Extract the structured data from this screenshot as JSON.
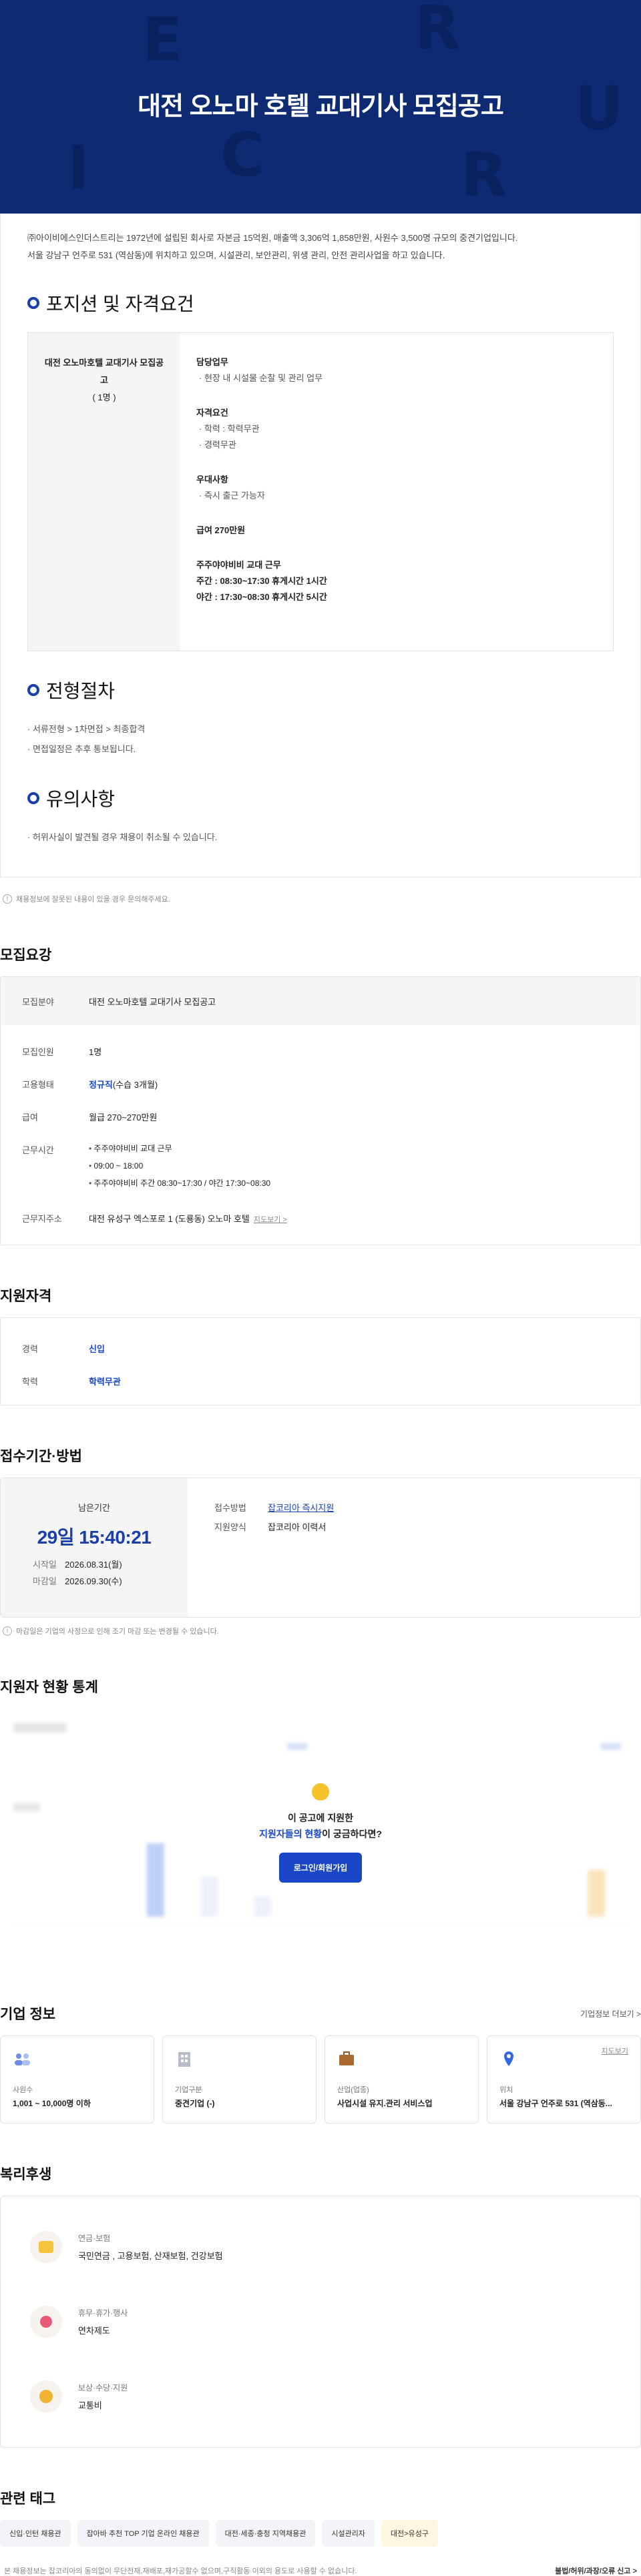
{
  "hero": {
    "title": "대전 오노마 호텔 교대기사 모집공고"
  },
  "detail": {
    "intro1": "㈜아이비에스인더스트리는 1972년에 설립된 회사로 자본금 15억원, 매출액 3,306억 1,858만원, 사원수 3,500명 규모의 중견기업입니다.",
    "intro2": "서울 강남구 언주로 531 (역삼동)에 위치하고 있으며, 시설관리, 보안관리, 위생 관리, 안전 관리사업을 하고 있습니다.",
    "sec1": "포지션 및 자격요건",
    "position_name": "대전 오노마호텔 교대기사 모집공고",
    "position_count": "( 1명 )",
    "duty_h": "담당업무",
    "duty_i": "· 현장 내 시설물 순찰 및 관리 업무",
    "qual_h": "자격요건",
    "qual_i1": "· 학력 : 학력무관",
    "qual_i2": "· 경력무관",
    "pref_h": "우대사항",
    "pref_i": "· 즉시 출근 가능자",
    "pay": "급여 270만원",
    "shift": "주주야야비비 교대 근무",
    "day": "주간 : 08:30~17:30 휴게시간 1시간",
    "night": "야간 : 17:30~08:30 휴게시간 5시간",
    "sec2": "전형절차",
    "proc1": "· 서류전형 > 1차면접 > 최종합격",
    "proc2": "· 면접일정은 추후 통보됩니다.",
    "sec3": "유의사항",
    "note1": "· 허위사실이 발견될 경우 채용이 취소될 수 있습니다."
  },
  "note_change": "채용정보에 잘못된 내용이 있을 경우 문의해주세요.",
  "req": {
    "title": "모집요강",
    "field_l": "모집분야",
    "field_v": "대전 오노마호텔 교대기사 모집공고",
    "num_l": "모집인원",
    "num_v": "1명",
    "emp_l": "고용형태",
    "emp_v": "정규직",
    "emp_sub": "(수습 3개월)",
    "pay_l": "급여",
    "pay_v": "월급 270~270만원",
    "time_l": "근무시간",
    "time_items": [
      "주주야야비비 교대 근무",
      "09:00 ~ 18:00",
      "주주야야비비 주간 08:30~17:30 / 야간 17:30~08:30"
    ],
    "addr_l": "근무지주소",
    "addr_v": "대전 유성구 엑스포로 1 (도룡동) 오노마 호텔",
    "addr_link": "지도보기 >"
  },
  "qual": {
    "title": "지원자격",
    "career_l": "경력",
    "career_v": "신입",
    "edu_l": "학력",
    "edu_v": "학력무관"
  },
  "period": {
    "title": "접수기간·방법",
    "remain_l": "남은기간",
    "remain_v": "29일 15:40:21",
    "start_l": "시작일",
    "start_v": "2026.08.31(월)",
    "end_l": "마감일",
    "end_v": "2026.09.30(수)",
    "method_l": "접수방법",
    "method_v": "잡코리아 즉시지원",
    "form_l": "지원양식",
    "form_v": "잡코리아 이력서",
    "note": "마감일은 기업의 사정으로 인해 조기 마감 또는 변경될 수 있습니다."
  },
  "stats": {
    "title": "지원자 현황 통계",
    "q1": "이 공고에 지원한",
    "q2a": "지원자들의 현황",
    "q2b": "이 궁금하다면?",
    "login": "로그인/회원가입"
  },
  "company": {
    "title": "기업 정보",
    "more": "기업정보 더보기 >",
    "cards": [
      {
        "label": "사원수",
        "value": "1,001 ~ 10,000명 이하"
      },
      {
        "label": "기업구분",
        "value": "중견기업 (-)"
      },
      {
        "label": "산업(업종)",
        "value": "사업시설 유지.관리 서비스업"
      },
      {
        "label": "위치",
        "value": "서울 강남구 언주로 531 (역삼동..."
      }
    ],
    "map": "지도보기"
  },
  "welfare": {
    "title": "복리후생",
    "items": [
      {
        "t": "연금·보험",
        "v": "국민연금 , 고용보험, 산재보험, 건강보험"
      },
      {
        "t": "휴무·휴가·행사",
        "v": "연차제도"
      },
      {
        "t": "보상·수당·지원",
        "v": "교통비"
      }
    ]
  },
  "tags": {
    "title": "관련 태그",
    "items": [
      "신입·인턴 채용관",
      "잡아바 추천 TOP 기업 온라인 채용관",
      "대전·세종·충청 지역채용관",
      "시설관리자",
      "대전>유성구"
    ]
  },
  "footer": {
    "left": "본 채용정보는 잡코리아의 동의없이 무단전재,재배포,재가공할수 없으며,구직활동 이외의 용도로 사용할 수 없습니다.",
    "right": "불법/허위/과장/오류 신고 >"
  },
  "colors": {
    "accent": "#1a3fa8",
    "hero_bg": "#0e2a72",
    "login_btn": "#1a47c8"
  }
}
